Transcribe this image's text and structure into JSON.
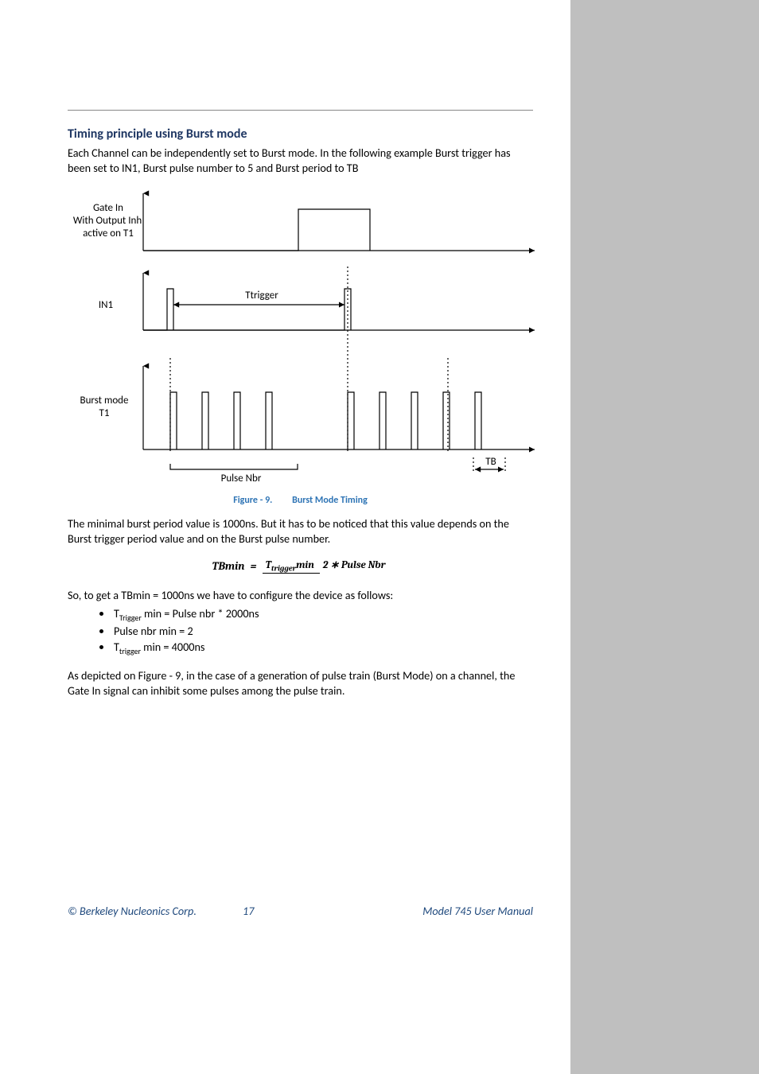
{
  "heading": "Timing principle using Burst mode",
  "intro": "Each Channel can be independently set to Burst mode. In the following example Burst trigger has been set to IN1, Burst pulse number to 5 and Burst period to TB",
  "figure": {
    "row1a": "Gate In",
    "row1b": "With Output Inh",
    "row1c": "active on T1",
    "row2": "IN1",
    "ttrigger": "Ttrigger",
    "row3a": "Burst mode",
    "row3b": "T1",
    "pulse_nbr": "Pulse Nbr",
    "tb": "TB"
  },
  "caption_num": "Figure - 9.",
  "caption_title": "Burst Mode Timing",
  "para_minimal": "The minimal burst period value is 1000ns. But it has to be noticed that this value depends on the Burst trigger period value and on the Burst pulse number.",
  "equation": {
    "lhs": "TBmin",
    "eq": "=",
    "num_pre": "T",
    "num_sub": "trigger",
    "num_post": "min",
    "den": "2 ∗ Pulse Nbr"
  },
  "para_so": "So, to get a TBmin = 1000ns we have to configure the device as follows:",
  "bullets": {
    "b1_pre": "T",
    "b1_sub": "Trigger",
    "b1_post": " min = Pulse nbr * 2000ns",
    "b2": "Pulse nbr min = 2",
    "b3_pre": "T",
    "b3_sub": "trigger",
    "b3_post": " min = 4000ns"
  },
  "para_depicted": "As depicted on Figure - 9, in the case of a generation of pulse train (Burst Mode) on a channel, the Gate In signal can inhibit some pulses among the pulse train.",
  "footer": {
    "left": "© Berkeley Nucleonics Corp.",
    "center": "17",
    "right": "Model 745 User Manual"
  }
}
